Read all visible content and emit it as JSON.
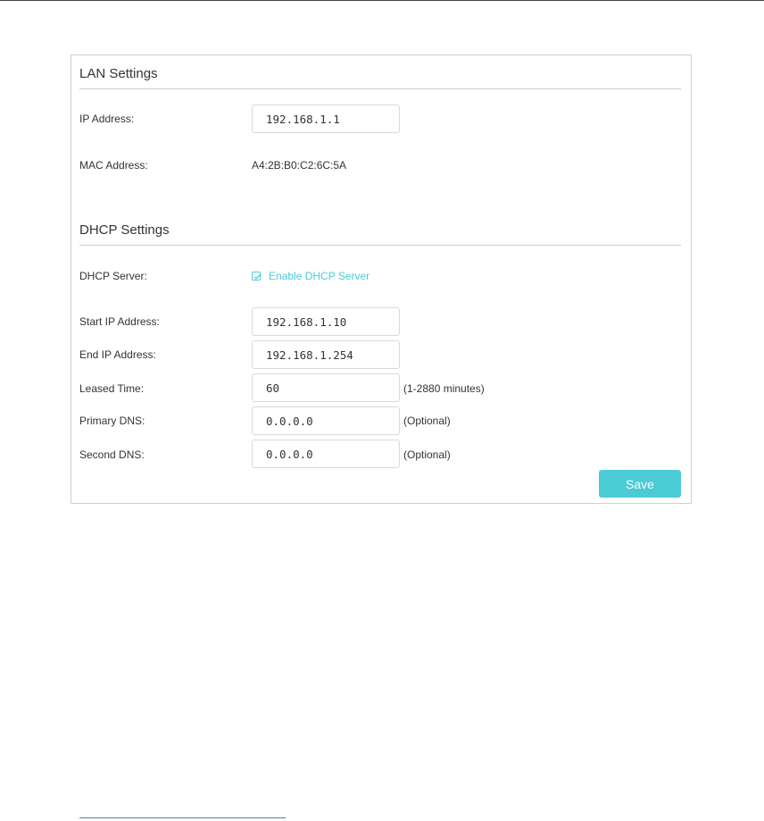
{
  "lan": {
    "title": "LAN Settings",
    "ip_label": "IP Address:",
    "ip_value": "192.168.1.1",
    "mac_label": "MAC Address:",
    "mac_value": "A4:2B:B0:C2:6C:5A"
  },
  "dhcp": {
    "title": "DHCP Settings",
    "server_label": "DHCP Server:",
    "enable_label": "Enable DHCP Server",
    "enabled": true,
    "start_label": "Start IP Address:",
    "start_value": "192.168.1.10",
    "end_label": "End IP Address:",
    "end_value": "192.168.1.254",
    "lease_label": "Leased Time:",
    "lease_value": "60",
    "lease_hint": "(1-2880 minutes)",
    "primary_dns_label": "Primary DNS:",
    "primary_dns_value": "0.0.0.0",
    "primary_dns_hint": "(Optional)",
    "second_dns_label": "Second DNS:",
    "second_dns_value": "0.0.0.0",
    "second_dns_hint": "(Optional)"
  },
  "actions": {
    "save_label": "Save"
  },
  "colors": {
    "accent": "#4acbd6",
    "border": "#cfcfcf",
    "text": "#333333"
  },
  "icons": {
    "checkbox": "checkmark-icon"
  }
}
